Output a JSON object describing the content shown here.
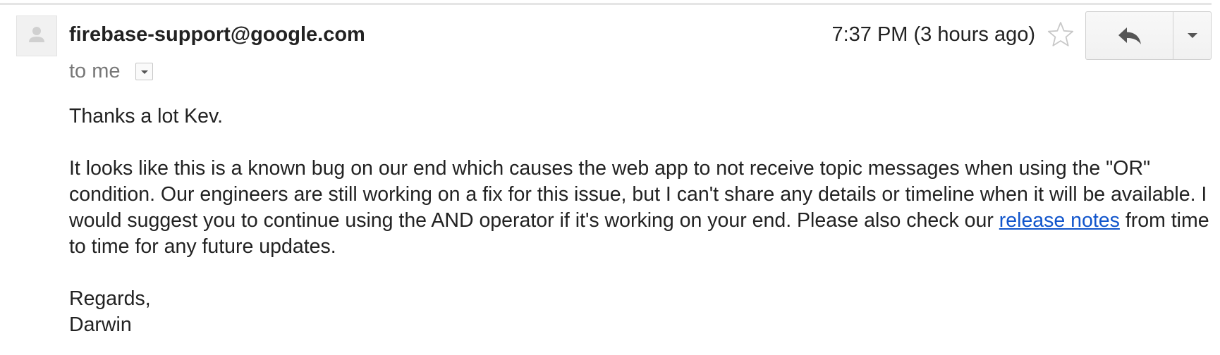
{
  "message": {
    "sender": "firebase-support@google.com",
    "recipient_line": "to me",
    "timestamp": "7:37 PM (3 hours ago)",
    "starred": false
  },
  "icons": {
    "avatar": "default-avatar-icon",
    "details": "chevron-down-icon",
    "star": "star-outline-icon",
    "reply": "reply-arrow-icon",
    "more": "caret-down-icon"
  },
  "body": {
    "greeting": "Thanks a lot Kev.",
    "paragraph_part1": "It looks like this is a known bug on our end which causes the web app to not receive topic messages when using the \"OR\" condition. Our engineers are still working on a fix for this issue, but I can't share any details or timeline when it will be available. I would suggest you to continue using the AND operator if it's working on your end. Please also check our ",
    "link_text": "release notes",
    "paragraph_part2": " from time to time for any future updates.",
    "closing": "Regards,",
    "signature": "Darwin"
  },
  "colors": {
    "link": "#1155cc",
    "muted_text": "#777777",
    "text": "#222222"
  }
}
